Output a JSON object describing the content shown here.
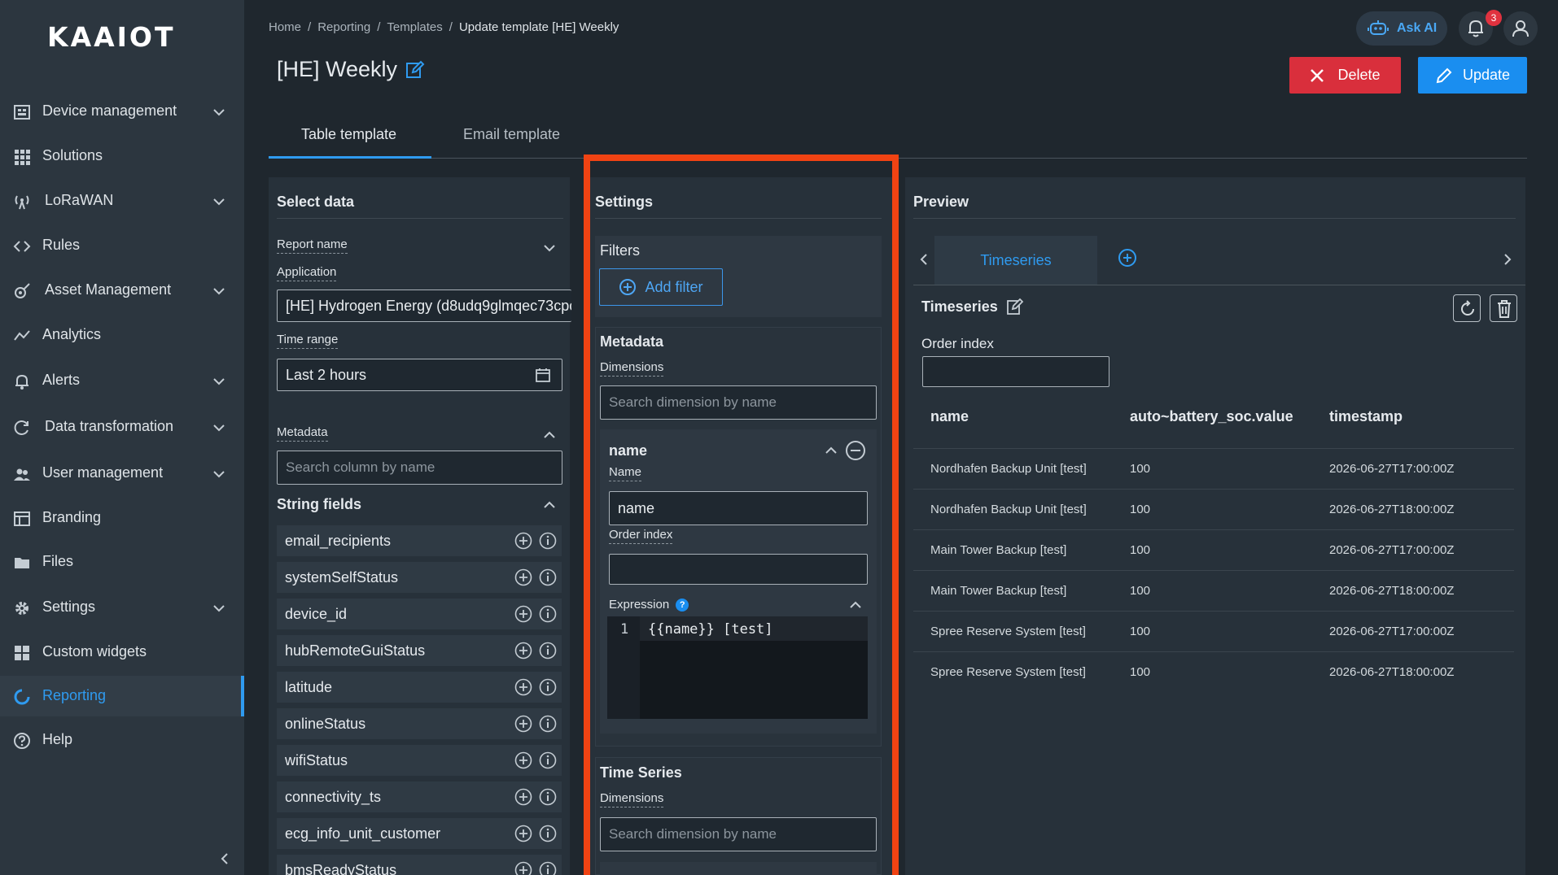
{
  "brand": {
    "logo_text": "KAAIOT"
  },
  "sidebar": {
    "items": [
      {
        "label": "Device management",
        "icon": "device-icon",
        "expandable": true
      },
      {
        "label": "Solutions",
        "icon": "grid-icon",
        "expandable": false
      },
      {
        "label": "LoRaWAN",
        "icon": "antenna-icon",
        "expandable": true
      },
      {
        "label": "Rules",
        "icon": "code-icon",
        "expandable": false
      },
      {
        "label": "Asset Management",
        "icon": "asset-icon",
        "expandable": true
      },
      {
        "label": "Analytics",
        "icon": "analytics-icon",
        "expandable": false
      },
      {
        "label": "Alerts",
        "icon": "bell-icon",
        "expandable": true
      },
      {
        "label": "Data transformation",
        "icon": "transform-icon",
        "expandable": true
      },
      {
        "label": "User management",
        "icon": "users-icon",
        "expandable": true
      },
      {
        "label": "Branding",
        "icon": "branding-icon",
        "expandable": false
      },
      {
        "label": "Files",
        "icon": "folder-icon",
        "expandable": false
      },
      {
        "label": "Settings",
        "icon": "gear-icon",
        "expandable": true
      },
      {
        "label": "Custom widgets",
        "icon": "widgets-icon",
        "expandable": false
      },
      {
        "label": "Reporting",
        "icon": "reporting-icon",
        "expandable": false,
        "active": true
      },
      {
        "label": "Help",
        "icon": "help-icon",
        "expandable": false
      }
    ]
  },
  "header": {
    "breadcrumb": [
      "Home",
      "Reporting",
      "Templates",
      "Update template [HE] Weekly"
    ],
    "title": "[HE] Weekly",
    "ask_ai": "Ask AI",
    "notifications_count": "3",
    "delete_label": "Delete",
    "update_label": "Update"
  },
  "tabs": [
    {
      "label": "Table template",
      "active": true
    },
    {
      "label": "Email template",
      "active": false
    }
  ],
  "select_data": {
    "title": "Select data",
    "report_name_label": "Report name",
    "application_label": "Application",
    "application_value": "[HE] Hydrogen Energy (d8udq9glmqec73cpc",
    "time_range_label": "Time range",
    "time_range_value": "Last 2 hours",
    "metadata_label": "Metadata",
    "metadata_search_placeholder": "Search column by name",
    "string_fields_label": "String fields",
    "string_fields": [
      "email_recipients",
      "systemSelfStatus",
      "device_id",
      "hubRemoteGuiStatus",
      "latitude",
      "onlineStatus",
      "wifiStatus",
      "connectivity_ts",
      "ecg_info_unit_customer",
      "bmsReadyStatus"
    ]
  },
  "settings": {
    "title": "Settings",
    "filters_label": "Filters",
    "add_filter_label": "Add filter",
    "metadata_label": "Metadata",
    "dimensions_label": "Dimensions",
    "dimension_search_placeholder": "Search dimension by name",
    "dimension": {
      "header": "name",
      "name_label": "Name",
      "name_value": "name",
      "order_index_label": "Order index",
      "order_index_value": "",
      "expression_label": "Expression",
      "expression_line_number": "1",
      "expression_value": "{{name}} [test]"
    },
    "time_series_label": "Time Series",
    "ts_dimensions_label": "Dimensions",
    "ts_dimension_search_placeholder": "Search dimension by name"
  },
  "preview": {
    "title": "Preview",
    "tab_label": "Timeseries",
    "section_title": "Timeseries",
    "order_index_label": "Order index",
    "order_index_value": "",
    "columns": [
      "name",
      "auto~battery_soc.value",
      "timestamp"
    ],
    "rows": [
      [
        "Nordhafen Backup Unit [test]",
        "100",
        "2026-06-27T17:00:00Z"
      ],
      [
        "Nordhafen Backup Unit [test]",
        "100",
        "2026-06-27T18:00:00Z"
      ],
      [
        "Main Tower Backup [test]",
        "100",
        "2026-06-27T17:00:00Z"
      ],
      [
        "Main Tower Backup [test]",
        "100",
        "2026-06-27T18:00:00Z"
      ],
      [
        "Spree Reserve System [test]",
        "100",
        "2026-06-27T17:00:00Z"
      ],
      [
        "Spree Reserve System [test]",
        "100",
        "2026-06-27T18:00:00Z"
      ]
    ]
  },
  "colors": {
    "accent": "#2f9bf0",
    "danger": "#d92f3c",
    "highlight": "#f04313",
    "sidebar_bg": "#2c363f",
    "page_bg": "#1f272e"
  }
}
